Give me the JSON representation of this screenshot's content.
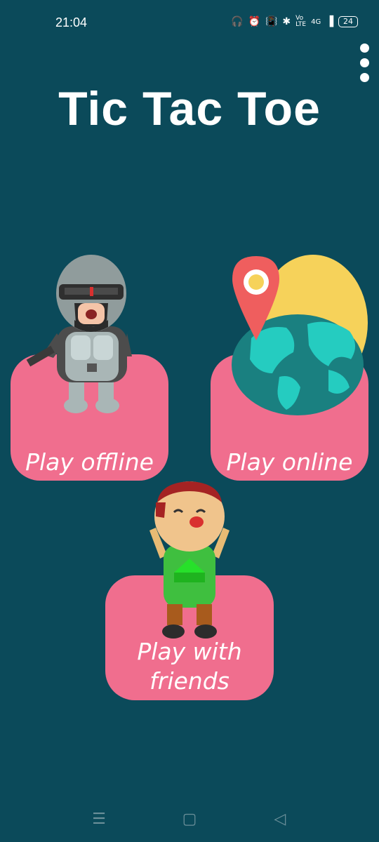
{
  "status_bar": {
    "time": "21:04",
    "icons": [
      "headphones-icon",
      "alarm-icon",
      "vibrate-icon",
      "bluetooth-icon",
      "volte-icon",
      "signal-icon"
    ],
    "network": "4G",
    "battery": "24"
  },
  "title": "Tic Tac Toe",
  "buttons": {
    "offline": "Play offline",
    "online": "Play online",
    "friends": "Play with friends"
  },
  "colors": {
    "background": "#0b4a5a",
    "card": "#f06e8e",
    "text": "#ffffff"
  },
  "nav": {
    "icons": [
      "menu-nav-icon",
      "home-nav-icon",
      "back-nav-icon"
    ]
  }
}
